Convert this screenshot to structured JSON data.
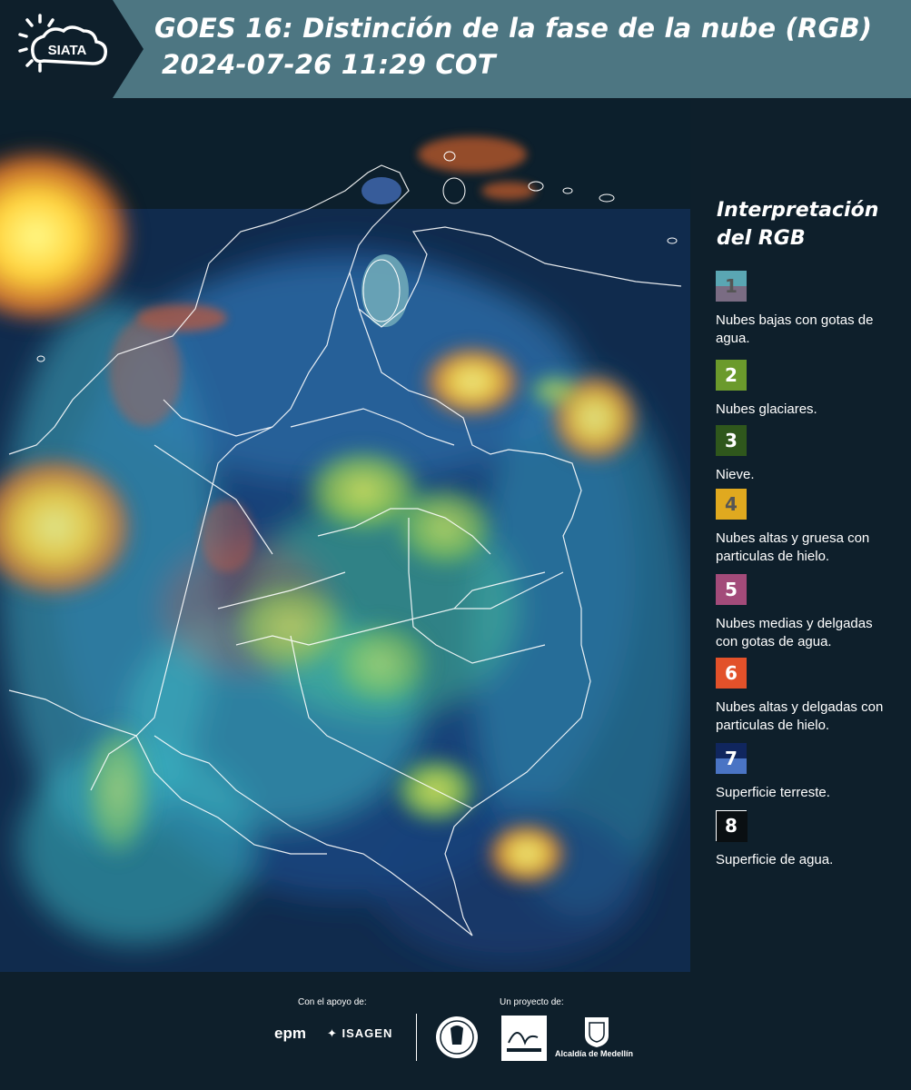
{
  "header": {
    "logo_text": "SIATA",
    "title_line1": "GOES 16: Distinción de la fase de la nube (RGB)",
    "title_line2": "2024-07-26 11:29 COT",
    "background_color": "#4d7682"
  },
  "legend": {
    "title_line1": "Interpretación",
    "title_line2": "del RGB",
    "items": [
      {
        "number": "1",
        "label": "Nubes bajas con gotas de agua.",
        "color_top": "#5aa6b3",
        "color_bottom": "#7a6c83"
      },
      {
        "number": "2",
        "label": "Nubes glaciares.",
        "color_top": "#6b9a2c",
        "color_bottom": "#6b9a2c"
      },
      {
        "number": "3",
        "label": "Nieve.",
        "color_top": "#2f571c",
        "color_bottom": "#2f571c"
      },
      {
        "number": "4",
        "label": "Nubes altas y gruesa con particulas de hielo.",
        "color_top": "#e0a91f",
        "color_bottom": "#e0a91f"
      },
      {
        "number": "5",
        "label": "Nubes medias y delgadas con gotas de agua.",
        "color_top": "#a34b7a",
        "color_bottom": "#a34b7a"
      },
      {
        "number": "6",
        "label": "Nubes altas y delgadas con particulas de hielo.",
        "color_top": "#e2512a",
        "color_bottom": "#e2512a"
      },
      {
        "number": "7",
        "label": "Superficie terreste.",
        "color_top": "#10265e",
        "color_bottom": "#4a74c4"
      },
      {
        "number": "8",
        "label": "Superficie de agua.",
        "color_top": "#0a0f12",
        "color_bottom": "#0a0f12"
      }
    ]
  },
  "footer": {
    "support_label": "Con el apoyo de:",
    "project_label": "Un proyecto de:",
    "sponsor_epm": "epm",
    "sponsor_isagen": "ISAGEN",
    "partner_alcaldia": "Alcaldía de Medellín"
  },
  "map": {
    "icons": [
      "satellite-image",
      "colombia-border-outline"
    ]
  }
}
